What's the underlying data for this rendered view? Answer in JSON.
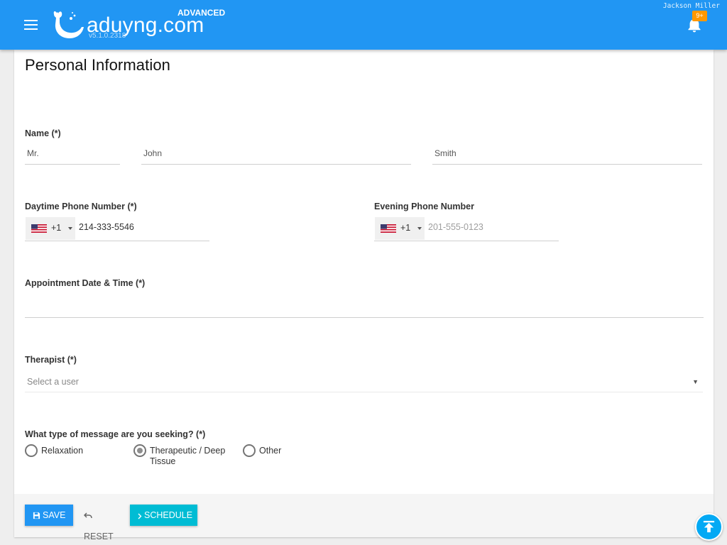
{
  "header": {
    "brand": "aduyng.com",
    "version": "v5.1.0.2318",
    "edition": "ADVANCED",
    "user_name": "Jackson Miller",
    "notification_badge": "9+",
    "color": "#2196f3",
    "icons": [
      "menu-icon",
      "whale-logo-icon",
      "bell-icon"
    ]
  },
  "form": {
    "title": "Personal Information",
    "name": {
      "label": "Name (*)",
      "prefix": "Mr.",
      "first": "John",
      "last": "Smith"
    },
    "daytime_phone": {
      "label": "Daytime Phone Number (*)",
      "country_code": "+1",
      "value": "214-333-5546",
      "flag_icon": "us-flag-icon"
    },
    "evening_phone": {
      "label": "Evening Phone Number",
      "country_code": "+1",
      "placeholder": "201-555-0123",
      "flag_icon": "us-flag-icon"
    },
    "appointment": {
      "label": "Appointment Date & Time (*)",
      "value": ""
    },
    "therapist": {
      "label": "Therapist (*)",
      "placeholder": "Select a user"
    },
    "message_type": {
      "label": "What type of message are you seeking? (*)",
      "options": [
        {
          "label": "Relaxation",
          "selected": false
        },
        {
          "label": "Therapeutic / Deep Tissue",
          "selected": true
        },
        {
          "label": "Other",
          "selected": false
        }
      ]
    }
  },
  "actions": {
    "save": "SAVE",
    "reset": "RESET",
    "schedule": "SCHEDULE",
    "save_color": "#2196f3",
    "schedule_color": "#00bcd4"
  },
  "scroll_top_icon": "scroll-to-top-icon"
}
